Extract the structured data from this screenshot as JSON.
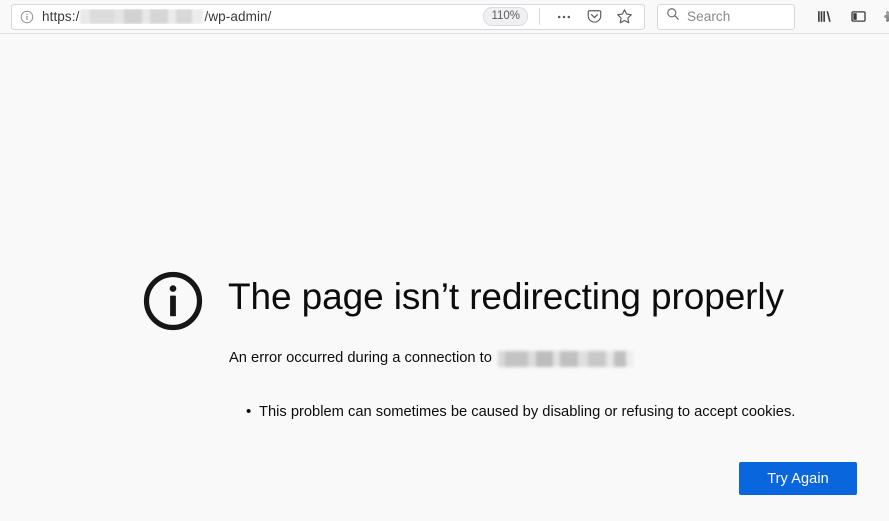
{
  "browser": {
    "urlbar": {
      "identity_icon": "info-circle-icon",
      "scheme_text": "https:/",
      "redacted_host": "",
      "path_text": "/wp-admin/",
      "zoom_level": "110%",
      "page_actions_icon": "ellipsis-icon",
      "pocket_icon": "pocket-icon",
      "bookmark_icon": "star-icon"
    },
    "search": {
      "icon": "search-icon",
      "placeholder": "Search",
      "value": ""
    },
    "right_icons": [
      {
        "name": "library-icon",
        "label": "Library"
      },
      {
        "name": "sidebar-icon",
        "label": "Sidebars"
      },
      {
        "name": "gear-icon",
        "label": "Settings"
      }
    ]
  },
  "error_page": {
    "icon": "info-circle-icon",
    "title": "The page isn’t redirecting properly",
    "description_prefix": "An error occurred during a connection to",
    "redacted_host": "",
    "bullets": [
      "This problem can sometimes be caused by disabling or refusing to accept cookies."
    ],
    "retry_button_label": "Try Again"
  },
  "colors": {
    "accent_blue": "#0a66dd",
    "chrome_background": "#f9f9fa",
    "content_background": "#f9f9fa",
    "text": "#0c0c0d",
    "border": "#d7d7db"
  }
}
